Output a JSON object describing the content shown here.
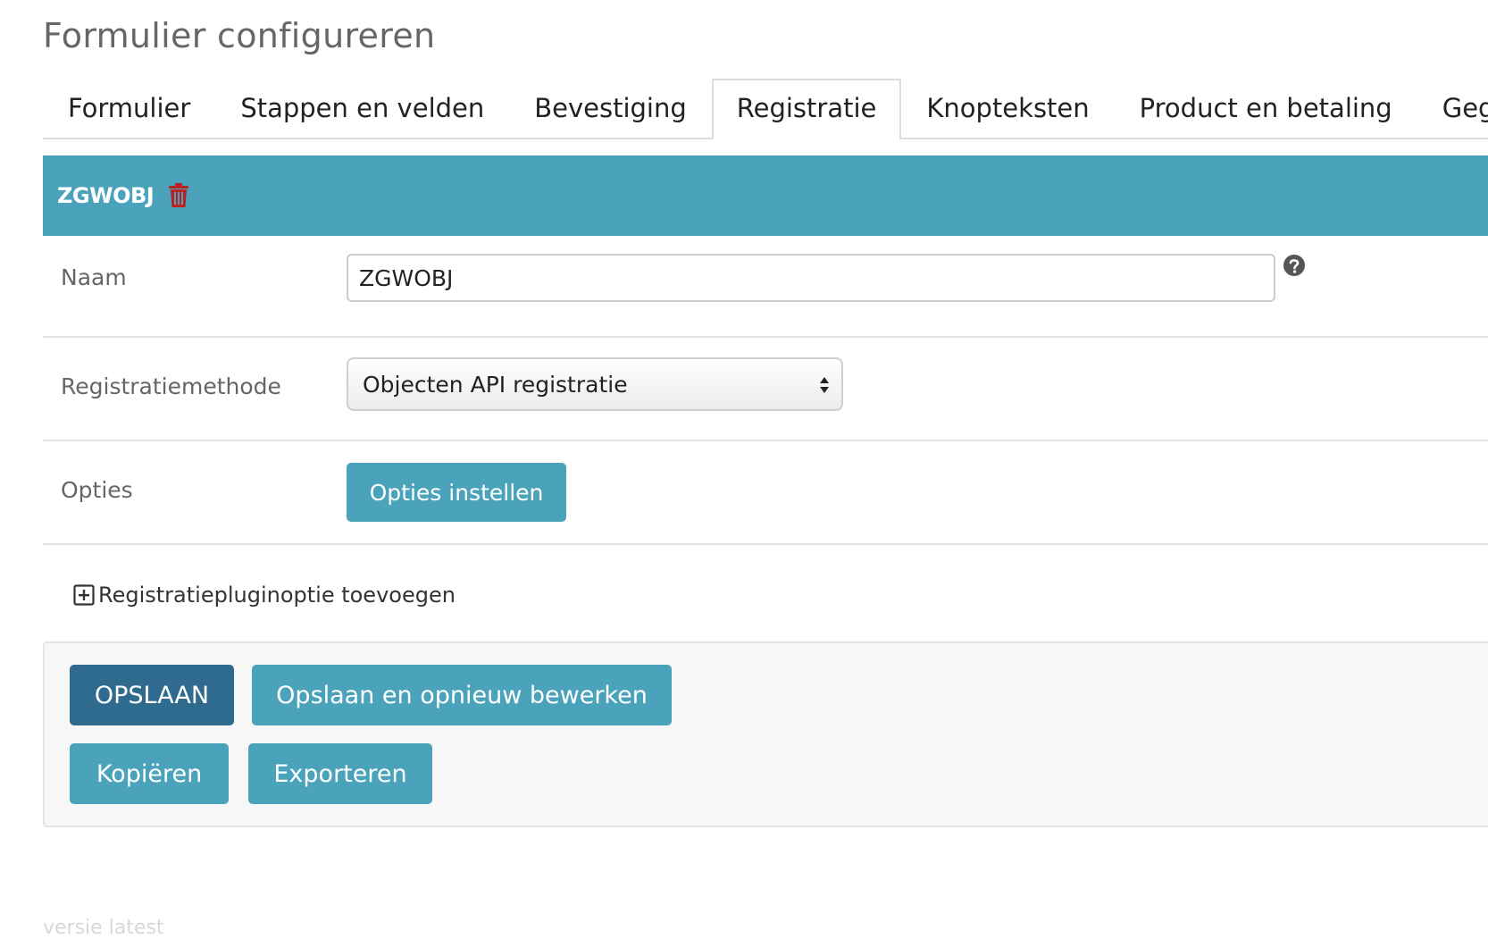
{
  "page": {
    "title": "Formulier configureren"
  },
  "tabs": [
    {
      "label": "Formulier"
    },
    {
      "label": "Stappen en velden"
    },
    {
      "label": "Bevestiging"
    },
    {
      "label": "Registratie"
    },
    {
      "label": "Knopteksten"
    },
    {
      "label": "Product en betaling"
    },
    {
      "label": "Gegeve"
    }
  ],
  "active_tab": "Registratie",
  "registration": {
    "header_title": "ZGWOBJ",
    "fields": {
      "name_label": "Naam",
      "name_value": "ZGWOBJ",
      "method_label": "Registratiemethode",
      "method_value": "Objecten API registratie",
      "options_label": "Opties",
      "options_button": "Opties instellen"
    },
    "add_option_label": "Registratiepluginoptie toevoegen"
  },
  "actions": {
    "save": "OPSLAAN",
    "save_continue": "Opslaan en opnieuw bewerken",
    "copy": "Kopiëren",
    "export": "Exporteren"
  },
  "footer": {
    "version": "versie latest"
  },
  "colors": {
    "accent": "#4ba3bb",
    "primary_button": "#2e6b8e",
    "danger": "#ba2121"
  },
  "icons": {
    "delete": "trash-icon",
    "help": "question-circle-icon",
    "add": "plus-square-icon",
    "select": "select-arrows-icon"
  }
}
